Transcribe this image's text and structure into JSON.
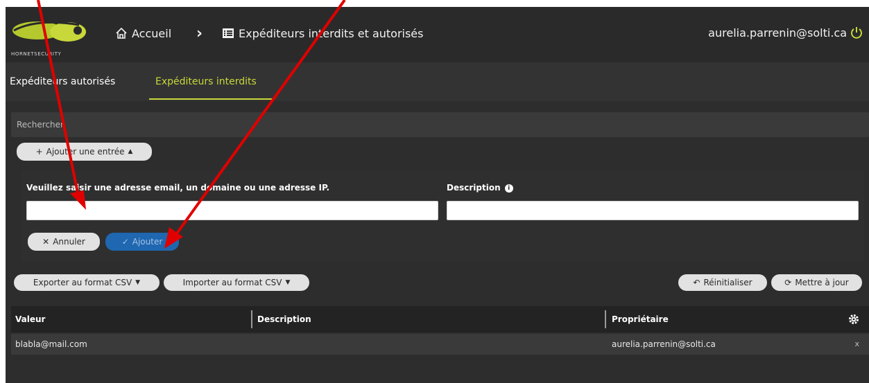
{
  "header": {
    "logo_text": "HORNETSECURITY",
    "home_icon": "home-icon",
    "home_label": "Accueil",
    "breadcrumb_separator": "›",
    "list_icon": "list-icon",
    "page_title": "Expéditeurs interdits et autorisés",
    "user_email": "aurelia.parrenin@solti.ca",
    "power_icon": "power-icon"
  },
  "tabs": [
    {
      "label": "Expéditeurs autorisés",
      "active": false
    },
    {
      "label": "Expéditeurs interdits",
      "active": true
    }
  ],
  "search": {
    "placeholder": "Rechercher"
  },
  "add_entry": {
    "label": "Ajouter une entrée",
    "icon": "plus-icon",
    "caret": "caret-up-icon"
  },
  "form": {
    "address_label": "Veuillez saisir une adresse email, un domaine ou une adresse IP.",
    "address_value": "",
    "description_label": "Description",
    "description_value": "",
    "info_icon": "info-icon",
    "cancel_label": "Annuler",
    "cancel_icon": "close-icon",
    "submit_label": "Ajouter",
    "submit_icon": "check-icon"
  },
  "toolbar": {
    "export_label": "Exporter au format CSV",
    "import_label": "Importer au format CSV",
    "reset_label": "Réinitialiser",
    "refresh_label": "Mettre à jour"
  },
  "table": {
    "columns": [
      "Valeur",
      "Description",
      "Propriétaire"
    ],
    "settings_icon": "gear-icon",
    "rows": [
      {
        "value": "blabla@mail.com",
        "description": "",
        "owner": "aurelia.parrenin@solti.ca",
        "action": "x"
      }
    ]
  },
  "colors": {
    "accent": "#c8d83a",
    "primary_button": "#1f67b0",
    "annotation_arrow": "#e00000"
  }
}
